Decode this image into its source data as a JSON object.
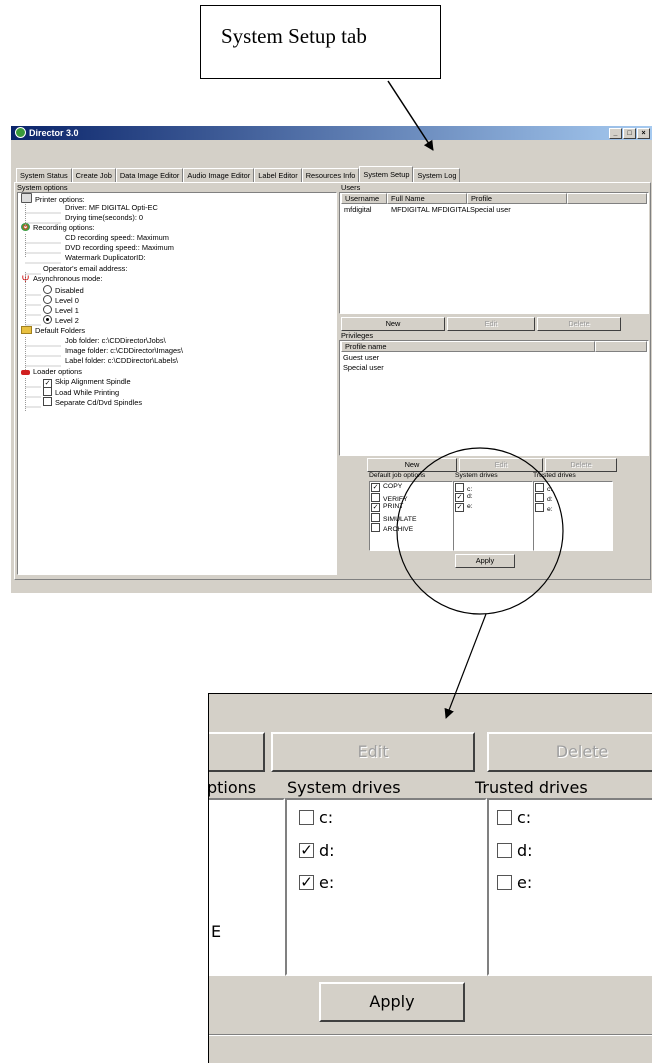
{
  "callout": {
    "text": "System Setup tab"
  },
  "window": {
    "title": "Director 3.0",
    "controls": {
      "minimize": "_",
      "maximize": "□",
      "close": "×"
    },
    "tabs": [
      "System Status",
      "Create Job",
      "Data Image Editor",
      "Audio Image Editor",
      "Label Editor",
      "Resources Info",
      "System Setup",
      "System Log"
    ],
    "active_tab": "System Setup",
    "system_options": {
      "label": "System options",
      "printer": {
        "title": "Printer options:",
        "driver": "Driver: MF DIGITAL Opti-EC",
        "drying": "Drying time(seconds): 0"
      },
      "recording": {
        "title": "Recording options:",
        "cd": "CD recording speed:: Maximum",
        "dvd": "DVD recording speed:: Maximum",
        "watermark": "Watermark DuplicatorID:"
      },
      "email": "Operator's email address:",
      "async": {
        "title": "Asynchronous mode:",
        "options": [
          "Disabled",
          "Level 0",
          "Level 1",
          "Level 2"
        ],
        "selected": "Level 2"
      },
      "folders": {
        "title": "Default Folders",
        "job": "Job folder: c:\\CDDirector\\Jobs\\",
        "image": "Image folder: c:\\CDDirector\\Images\\",
        "label": "Label folder: c:\\CDDirector\\Labels\\"
      },
      "loader": {
        "title": "Loader options",
        "items": [
          {
            "label": "Skip Alignment Spindle",
            "checked": true
          },
          {
            "label": "Load While Printing",
            "checked": false
          },
          {
            "label": "Separate Cd/Dvd Spindles",
            "checked": false
          }
        ]
      }
    },
    "users": {
      "label": "Users",
      "columns": [
        "Username",
        "Full Name",
        "Profile"
      ],
      "rows": [
        {
          "username": "mfdigital",
          "fullname": "MFDIGITAL MFDIGITAL",
          "profile": "Special user"
        }
      ],
      "buttons": {
        "new": "New",
        "edit": "Edit",
        "delete": "Delete"
      }
    },
    "privileges": {
      "label": "Privileges",
      "column": "Profile name",
      "rows": [
        "Guest user",
        "Special user"
      ],
      "buttons": {
        "new": "New",
        "edit": "Edit",
        "delete": "Delete"
      }
    },
    "job_options": {
      "default_label": "Default job options",
      "system_label": "System drives",
      "trusted_label": "Trusted drives",
      "defaults": [
        {
          "label": "COPY",
          "checked": true
        },
        {
          "label": "VERIFY",
          "checked": false
        },
        {
          "label": "PRINT",
          "checked": true
        },
        {
          "label": "SIMULATE",
          "checked": false
        },
        {
          "label": "ARCHIVE",
          "checked": false
        }
      ],
      "system_drives": [
        {
          "label": "c:",
          "checked": false
        },
        {
          "label": "d:",
          "checked": true
        },
        {
          "label": "e:",
          "checked": true
        }
      ],
      "trusted_drives": [
        {
          "label": "c:",
          "checked": false
        },
        {
          "label": "d:",
          "checked": false
        },
        {
          "label": "e:",
          "checked": false
        }
      ],
      "apply": "Apply"
    }
  },
  "zoom": {
    "edit": "Edit",
    "delete": "Delete",
    "options_partial": "ptions",
    "system_label": "System drives",
    "trusted_label": "Trusted drives",
    "partial_e": "E",
    "system_drives": [
      {
        "label": "c:",
        "checked": false
      },
      {
        "label": "d:",
        "checked": true
      },
      {
        "label": "e:",
        "checked": true
      }
    ],
    "trusted_drives": [
      {
        "label": "c:",
        "checked": false
      },
      {
        "label": "d:",
        "checked": false
      },
      {
        "label": "e:",
        "checked": false
      }
    ],
    "apply": "Apply"
  }
}
